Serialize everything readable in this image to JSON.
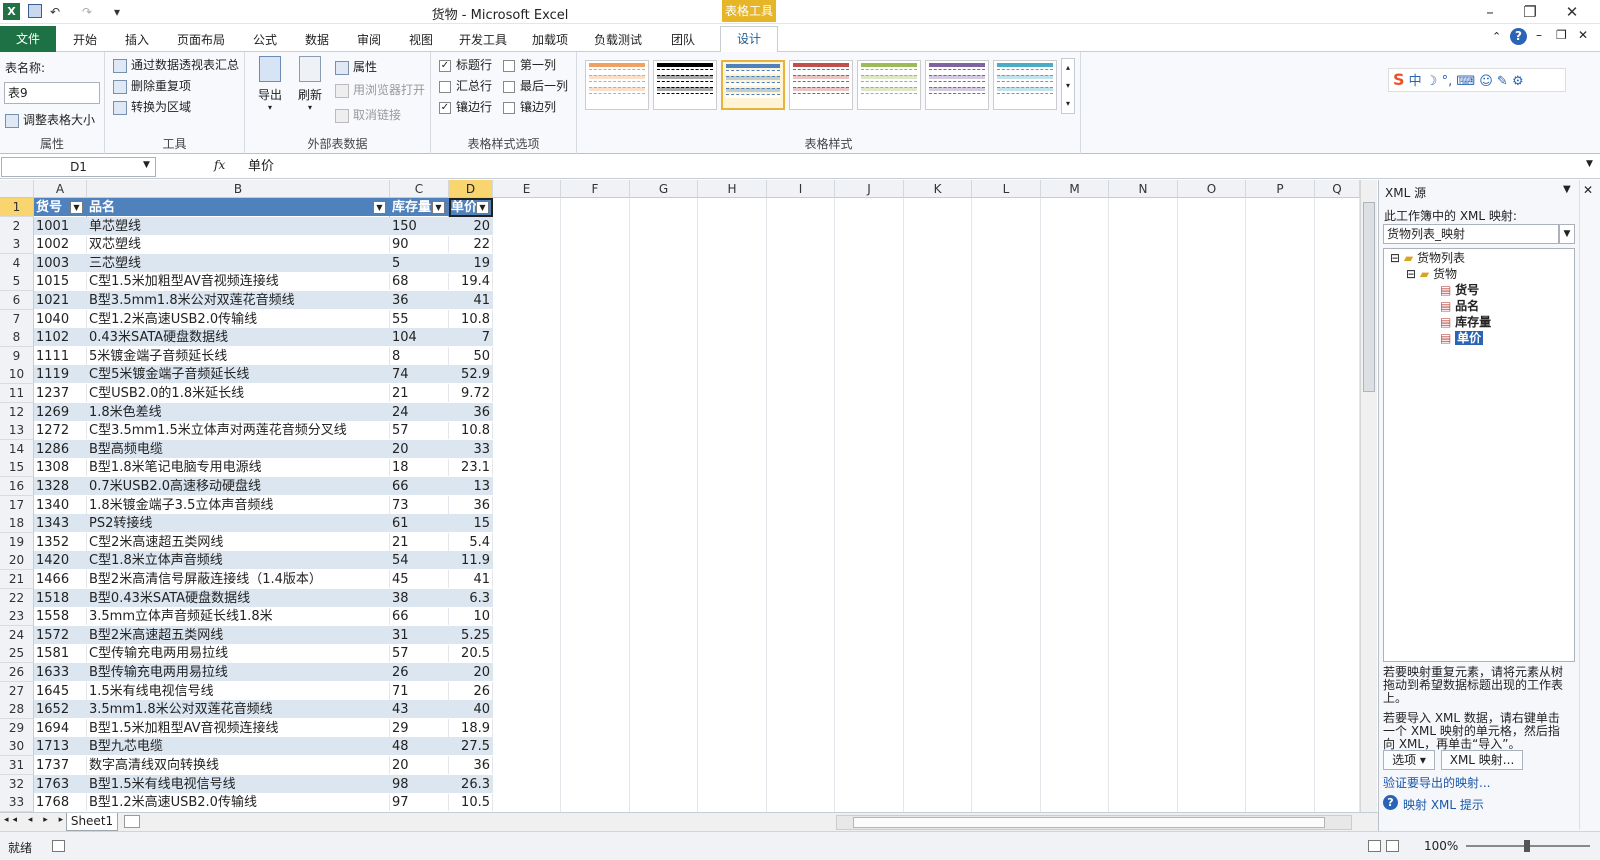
{
  "titlebar": {
    "title": "货物 - Microsoft Excel",
    "context_tab": "表格工具",
    "undo": "↶",
    "redo": "↷"
  },
  "tabs": [
    "文件",
    "开始",
    "插入",
    "页面布局",
    "公式",
    "数据",
    "审阅",
    "视图",
    "开发工具",
    "加载项",
    "负载测试",
    "团队",
    "设计"
  ],
  "ribbon": {
    "props": {
      "table_name_label": "表名称:",
      "table_name": "表9",
      "resize": "调整表格大小",
      "group": "属性"
    },
    "tools": {
      "pivot": "通过数据透视表汇总",
      "dedupe": "删除重复项",
      "convert": "转换为区域",
      "group": "工具"
    },
    "external": {
      "export": "导出",
      "refresh": "刷新",
      "properties": "属性",
      "open_browser": "用浏览器打开",
      "unlink": "取消链接",
      "group": "外部表数据"
    },
    "style_options": {
      "header_row": "标题行",
      "total_row": "汇总行",
      "banded_rows": "镶边行",
      "first_col": "第一列",
      "last_col": "最后一列",
      "banded_cols": "镶边列",
      "group": "表格样式选项",
      "header_checked": true,
      "total_checked": false,
      "banded_checked": true,
      "first_checked": false,
      "last_checked": false,
      "bandedcol_checked": false
    },
    "styles": {
      "group": "表格样式",
      "colors": [
        "#f0a060",
        "#000000",
        "#4f81bd",
        "#c0504d",
        "#9bbb59",
        "#8064a2",
        "#4bacc6"
      ]
    }
  },
  "formula": {
    "namebox": "D1",
    "fx": "fx",
    "content": "单价"
  },
  "sheet": {
    "columns": [
      "A",
      "B",
      "C",
      "D",
      "E",
      "F",
      "G",
      "H",
      "I",
      "J",
      "K",
      "L",
      "M",
      "N",
      "O",
      "P",
      "Q"
    ],
    "headers": [
      "货号",
      "品名",
      "库存量",
      "单价"
    ],
    "rows": [
      [
        "1001",
        "单芯塑线",
        "150",
        "20"
      ],
      [
        "1002",
        "双芯塑线",
        "90",
        "22"
      ],
      [
        "1003",
        "三芯塑线",
        "5",
        "19"
      ],
      [
        "1015",
        "C型1.5米加粗型AV音视频连接线",
        "68",
        "19.4"
      ],
      [
        "1021",
        "B型3.5mm1.8米公对双莲花音频线",
        "36",
        "41"
      ],
      [
        "1040",
        "C型1.2米高速USB2.0传输线",
        "55",
        "10.8"
      ],
      [
        "1102",
        "0.43米SATA硬盘数据线",
        "104",
        "7"
      ],
      [
        "1111",
        "5米镀金端子音频延长线",
        "8",
        "50"
      ],
      [
        "1119",
        "C型5米镀金端子音频延长线",
        "74",
        "52.9"
      ],
      [
        "1237",
        "C型USB2.0的1.8米延长线",
        "21",
        "9.72"
      ],
      [
        "1269",
        "1.8米色差线",
        "24",
        "36"
      ],
      [
        "1272",
        "C型3.5mm1.5米立体声对两莲花音频分叉线",
        "57",
        "10.8"
      ],
      [
        "1286",
        "B型高频电缆",
        "20",
        "33"
      ],
      [
        "1308",
        "B型1.8米笔记电脑专用电源线",
        "18",
        "23.1"
      ],
      [
        "1328",
        "0.7米USB2.0高速移动硬盘线",
        "66",
        "13"
      ],
      [
        "1340",
        "1.8米镀金端子3.5立体声音频线",
        "73",
        "36"
      ],
      [
        "1343",
        "PS2转接线",
        "61",
        "15"
      ],
      [
        "1352",
        "C型2米高速超五类网线",
        "21",
        "5.4"
      ],
      [
        "1420",
        "C型1.8米立体声音频线",
        "54",
        "11.9"
      ],
      [
        "1466",
        "B型2米高清信号屏蔽连接线（1.4版本）",
        "45",
        "41"
      ],
      [
        "1518",
        "B型0.43米SATA硬盘数据线",
        "38",
        "6.3"
      ],
      [
        "1558",
        "3.5mm立体声音频延长线1.8米",
        "66",
        "10"
      ],
      [
        "1572",
        "B型2米高速超五类网线",
        "31",
        "5.25"
      ],
      [
        "1581",
        "C型传输充电两用易拉线",
        "57",
        "20.5"
      ],
      [
        "1633",
        "B型传输充电两用易拉线",
        "26",
        "20"
      ],
      [
        "1645",
        "1.5米有线电视信号线",
        "71",
        "26"
      ],
      [
        "1652",
        "3.5mm1.8米公对双莲花音频线",
        "43",
        "40"
      ],
      [
        "1694",
        "B型1.5米加粗型AV音视频连接线",
        "29",
        "18.9"
      ],
      [
        "1713",
        "B型九芯电缆",
        "48",
        "27.5"
      ],
      [
        "1737",
        "数字高清线双向转换线",
        "20",
        "36"
      ],
      [
        "1763",
        "B型1.5米有线电视信号线",
        "98",
        "26.3"
      ],
      [
        "1768",
        "B型1.2米高速USB2.0传输线",
        "97",
        "10.5"
      ]
    ],
    "tab": "Sheet1"
  },
  "status": {
    "ready": "就绪",
    "zoom": "100%"
  },
  "xml": {
    "title": "XML 源",
    "maps_label": "此工作簿中的 XML 映射:",
    "map": "货物列表_映射",
    "tree": [
      "货物列表",
      "货物",
      "货号",
      "品名",
      "库存量",
      "单价"
    ],
    "hint1": "若要映射重复元素，请将元素从树拖动到希望数据标题出现的工作表上。",
    "hint2": "若要导入 XML 数据，请右键单击一个 XML 映射的单元格，然后指向 XML，再单击“导入”。",
    "options": "选项 ▾",
    "maps_btn": "XML 映射...",
    "verify": "验证要导出的映射...",
    "tips": "映射 XML 提示"
  }
}
